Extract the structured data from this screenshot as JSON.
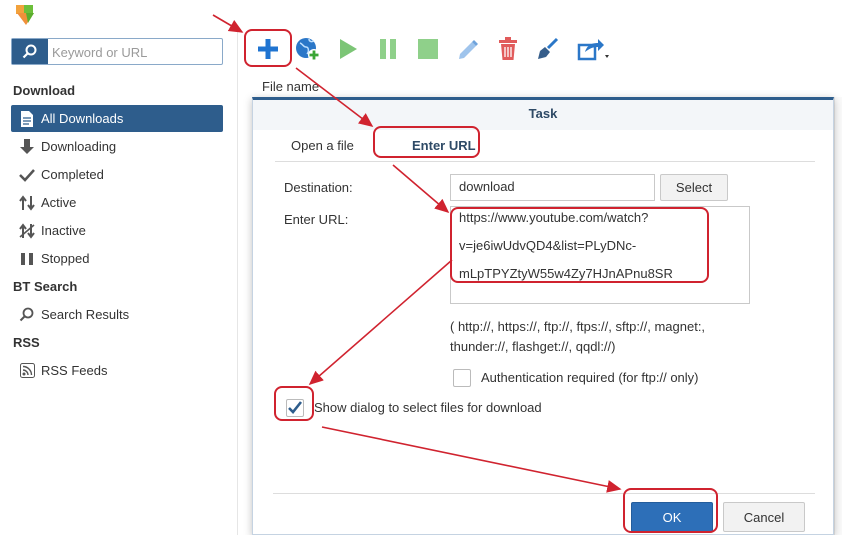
{
  "search": {
    "placeholder": "Keyword or URL"
  },
  "sidebar": {
    "download_heading": "Download",
    "items": [
      {
        "label": "All Downloads",
        "icon": "document-icon"
      },
      {
        "label": "Downloading",
        "icon": "arrow-down-icon"
      },
      {
        "label": "Completed",
        "icon": "checkmark-icon"
      },
      {
        "label": "Active",
        "icon": "up-down-arrows-icon"
      },
      {
        "label": "Inactive",
        "icon": "inactive-icon"
      },
      {
        "label": "Stopped",
        "icon": "pause-icon"
      }
    ],
    "bt_heading": "BT Search",
    "search_results": "Search Results",
    "rss_heading": "RSS",
    "rss_feeds": "RSS Feeds"
  },
  "toolbar": {
    "buttons": [
      "add-icon",
      "globe-add-icon",
      "play-icon",
      "pause-icon",
      "stop-icon",
      "edit-icon",
      "delete-icon",
      "clear-icon",
      "share-icon"
    ]
  },
  "list": {
    "column_file_name": "File name"
  },
  "dialog": {
    "title": "Task",
    "tabs": [
      "Open a file",
      "Enter URL"
    ],
    "destination_label": "Destination:",
    "destination_value": "download",
    "select_button": "Select",
    "url_label": "Enter URL:",
    "url_lines": [
      "https://www.youtube.com/watch?",
      "v=je6iwUdvQD4&list=PLyDNc-",
      "mLpTPYZtyW55w4Zy7HJnAPnu8SR"
    ],
    "protocols_line1": "( http://, https://, ftp://, ftps://, sftp://, magnet:,",
    "protocols_line2": "thunder://, flashget://, qqdl://)",
    "auth_label": "Authentication required (for ftp:// only)",
    "show_dialog_label": "Show dialog to select files for download",
    "ok_button": "OK",
    "cancel_button": "Cancel"
  },
  "colors": {
    "accent": "#2e5d8c",
    "primary_button": "#2d6fb8",
    "callout_red": "#d0232f"
  }
}
